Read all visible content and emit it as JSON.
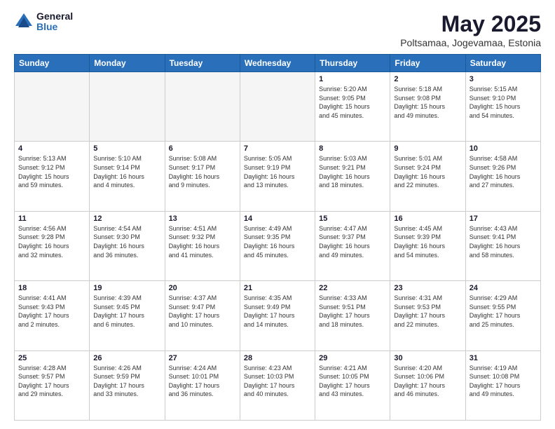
{
  "logo": {
    "general": "General",
    "blue": "Blue"
  },
  "title": "May 2025",
  "subtitle": "Poltsamaa, Jogevamaa, Estonia",
  "days_of_week": [
    "Sunday",
    "Monday",
    "Tuesday",
    "Wednesday",
    "Thursday",
    "Friday",
    "Saturday"
  ],
  "weeks": [
    [
      {
        "day": "",
        "info": "",
        "empty": true
      },
      {
        "day": "",
        "info": "",
        "empty": true
      },
      {
        "day": "",
        "info": "",
        "empty": true
      },
      {
        "day": "",
        "info": "",
        "empty": true
      },
      {
        "day": "1",
        "info": "Sunrise: 5:20 AM\nSunset: 9:05 PM\nDaylight: 15 hours\nand 45 minutes."
      },
      {
        "day": "2",
        "info": "Sunrise: 5:18 AM\nSunset: 9:08 PM\nDaylight: 15 hours\nand 49 minutes."
      },
      {
        "day": "3",
        "info": "Sunrise: 5:15 AM\nSunset: 9:10 PM\nDaylight: 15 hours\nand 54 minutes."
      }
    ],
    [
      {
        "day": "4",
        "info": "Sunrise: 5:13 AM\nSunset: 9:12 PM\nDaylight: 15 hours\nand 59 minutes."
      },
      {
        "day": "5",
        "info": "Sunrise: 5:10 AM\nSunset: 9:14 PM\nDaylight: 16 hours\nand 4 minutes."
      },
      {
        "day": "6",
        "info": "Sunrise: 5:08 AM\nSunset: 9:17 PM\nDaylight: 16 hours\nand 9 minutes."
      },
      {
        "day": "7",
        "info": "Sunrise: 5:05 AM\nSunset: 9:19 PM\nDaylight: 16 hours\nand 13 minutes."
      },
      {
        "day": "8",
        "info": "Sunrise: 5:03 AM\nSunset: 9:21 PM\nDaylight: 16 hours\nand 18 minutes."
      },
      {
        "day": "9",
        "info": "Sunrise: 5:01 AM\nSunset: 9:24 PM\nDaylight: 16 hours\nand 22 minutes."
      },
      {
        "day": "10",
        "info": "Sunrise: 4:58 AM\nSunset: 9:26 PM\nDaylight: 16 hours\nand 27 minutes."
      }
    ],
    [
      {
        "day": "11",
        "info": "Sunrise: 4:56 AM\nSunset: 9:28 PM\nDaylight: 16 hours\nand 32 minutes."
      },
      {
        "day": "12",
        "info": "Sunrise: 4:54 AM\nSunset: 9:30 PM\nDaylight: 16 hours\nand 36 minutes."
      },
      {
        "day": "13",
        "info": "Sunrise: 4:51 AM\nSunset: 9:32 PM\nDaylight: 16 hours\nand 41 minutes."
      },
      {
        "day": "14",
        "info": "Sunrise: 4:49 AM\nSunset: 9:35 PM\nDaylight: 16 hours\nand 45 minutes."
      },
      {
        "day": "15",
        "info": "Sunrise: 4:47 AM\nSunset: 9:37 PM\nDaylight: 16 hours\nand 49 minutes."
      },
      {
        "day": "16",
        "info": "Sunrise: 4:45 AM\nSunset: 9:39 PM\nDaylight: 16 hours\nand 54 minutes."
      },
      {
        "day": "17",
        "info": "Sunrise: 4:43 AM\nSunset: 9:41 PM\nDaylight: 16 hours\nand 58 minutes."
      }
    ],
    [
      {
        "day": "18",
        "info": "Sunrise: 4:41 AM\nSunset: 9:43 PM\nDaylight: 17 hours\nand 2 minutes."
      },
      {
        "day": "19",
        "info": "Sunrise: 4:39 AM\nSunset: 9:45 PM\nDaylight: 17 hours\nand 6 minutes."
      },
      {
        "day": "20",
        "info": "Sunrise: 4:37 AM\nSunset: 9:47 PM\nDaylight: 17 hours\nand 10 minutes."
      },
      {
        "day": "21",
        "info": "Sunrise: 4:35 AM\nSunset: 9:49 PM\nDaylight: 17 hours\nand 14 minutes."
      },
      {
        "day": "22",
        "info": "Sunrise: 4:33 AM\nSunset: 9:51 PM\nDaylight: 17 hours\nand 18 minutes."
      },
      {
        "day": "23",
        "info": "Sunrise: 4:31 AM\nSunset: 9:53 PM\nDaylight: 17 hours\nand 22 minutes."
      },
      {
        "day": "24",
        "info": "Sunrise: 4:29 AM\nSunset: 9:55 PM\nDaylight: 17 hours\nand 25 minutes."
      }
    ],
    [
      {
        "day": "25",
        "info": "Sunrise: 4:28 AM\nSunset: 9:57 PM\nDaylight: 17 hours\nand 29 minutes."
      },
      {
        "day": "26",
        "info": "Sunrise: 4:26 AM\nSunset: 9:59 PM\nDaylight: 17 hours\nand 33 minutes."
      },
      {
        "day": "27",
        "info": "Sunrise: 4:24 AM\nSunset: 10:01 PM\nDaylight: 17 hours\nand 36 minutes."
      },
      {
        "day": "28",
        "info": "Sunrise: 4:23 AM\nSunset: 10:03 PM\nDaylight: 17 hours\nand 40 minutes."
      },
      {
        "day": "29",
        "info": "Sunrise: 4:21 AM\nSunset: 10:05 PM\nDaylight: 17 hours\nand 43 minutes."
      },
      {
        "day": "30",
        "info": "Sunrise: 4:20 AM\nSunset: 10:06 PM\nDaylight: 17 hours\nand 46 minutes."
      },
      {
        "day": "31",
        "info": "Sunrise: 4:19 AM\nSunset: 10:08 PM\nDaylight: 17 hours\nand 49 minutes."
      }
    ]
  ]
}
